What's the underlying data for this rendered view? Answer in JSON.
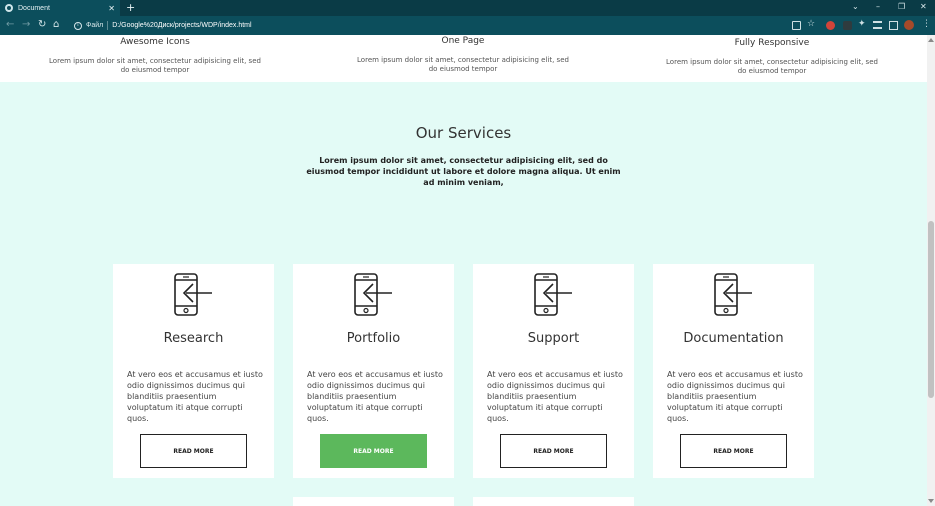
{
  "browser": {
    "tab_title": "Document",
    "tab_close": "✕",
    "new_tab": "+",
    "window_controls": {
      "dropdown": "⌄",
      "minimize": "–",
      "restore": "❐",
      "close": "✕"
    },
    "nav": {
      "back": "←",
      "forward": "→",
      "reload": "↻",
      "home": "⌂"
    },
    "address_label": "Файл",
    "url": "D:/Google%20Диск/projects/WDP/index.html",
    "menu": "⋮"
  },
  "features": [
    {
      "title": "Awesome Icons",
      "text": "Lorem ipsum dolor sit amet, consectetur adipisicing elit, sed do eiusmod tempor"
    },
    {
      "title": "One Page",
      "text": "Lorem ipsum dolor sit amet, consectetur adipisicing elit, sed do eiusmod tempor"
    },
    {
      "title": "Fully Responsive",
      "text": "Lorem ipsum dolor sit amet, consectetur adipisicing elit, sed do eiusmod tempor"
    }
  ],
  "services": {
    "title": "Our Services",
    "lead": "Lorem ipsum dolor sit amet, consectetur adipisicing elit, sed do eiusmod tempor incididunt ut labore et dolore magna aliqua. Ut enim ad minim veniam,",
    "cards": [
      {
        "icon": "phone-login-icon",
        "title": "Research",
        "text": "At vero eos et accusamus et iusto odio dignissimos ducimus qui blanditiis praesentium voluptatum iti atque corrupti quos.",
        "button": "READ MORE"
      },
      {
        "icon": "phone-login-icon",
        "title": "Portfolio",
        "text": "At vero eos et accusamus et iusto odio dignissimos ducimus qui blanditiis praesentium voluptatum iti atque corrupti quos.",
        "button": "READ MORE"
      },
      {
        "icon": "phone-login-icon",
        "title": "Support",
        "text": "At vero eos et accusamus et iusto odio dignissimos ducimus qui blanditiis praesentium voluptatum iti atque corrupti quos.",
        "button": "READ MORE"
      },
      {
        "icon": "phone-login-icon",
        "title": "Documentation",
        "text": "At vero eos et accusamus et iusto odio dignissimos ducimus qui blanditiis praesentium voluptatum iti atque corrupti quos.",
        "button": "READ MORE"
      }
    ]
  },
  "colors": {
    "page_bg": "#e3fbf6",
    "accent_green": "#5cb85c",
    "chrome_dark": "#0a3b46",
    "chrome": "#0c4e5c"
  }
}
